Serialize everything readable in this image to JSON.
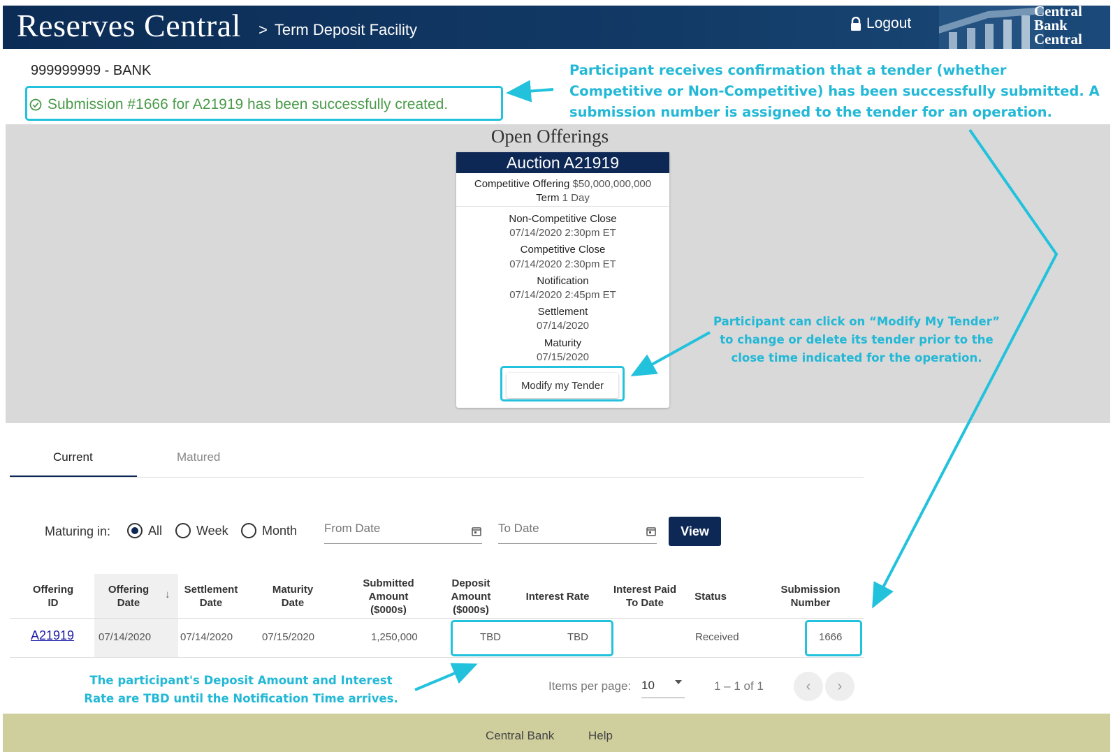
{
  "header": {
    "app_title": "Reserves Central",
    "breadcrumb_sep": ">",
    "breadcrumb": "Term Deposit Facility",
    "logout_label": "Logout",
    "logo_lines": [
      "Central",
      "Bank",
      "Central"
    ]
  },
  "institution": "999999999 - BANK",
  "success_message": "Submission #1666 for A21919 has been successfully created.",
  "annotations": {
    "confirmation": "Participant receives confirmation that a tender (whether Competitive or Non-Competitive) has been successfully submitted. A submission number is assigned to the tender for an operation.",
    "modify": "Participant can click on “Modify My Tender” to change or delete its tender prior to the close time indicated for the operation.",
    "tbd": "The participant's Deposit Amount and Interest Rate are TBD until the Notification Time arrives."
  },
  "offerings": {
    "title": "Open Offerings",
    "auction": {
      "title": "Auction A21919",
      "offering_label": "Competitive Offering",
      "offering_value": "$50,000,000,000",
      "term_label": "Term",
      "term_value": "1 Day",
      "schedule": [
        {
          "label": "Non-Competitive Close",
          "value": "07/14/2020 2:30pm ET"
        },
        {
          "label": "Competitive Close",
          "value": "07/14/2020 2:30pm ET"
        },
        {
          "label": "Notification",
          "value": "07/14/2020 2:45pm ET"
        },
        {
          "label": "Settlement",
          "value": "07/14/2020"
        },
        {
          "label": "Maturity",
          "value": "07/15/2020"
        }
      ],
      "modify_label": "Modify my Tender"
    }
  },
  "tabs": [
    {
      "label": "Current",
      "active": true
    },
    {
      "label": "Matured",
      "active": false
    }
  ],
  "filters": {
    "maturing_label": "Maturing in:",
    "options": [
      {
        "label": "All",
        "selected": true
      },
      {
        "label": "Week",
        "selected": false
      },
      {
        "label": "Month",
        "selected": false
      }
    ],
    "from_placeholder": "From Date",
    "to_placeholder": "To Date",
    "view_label": "View"
  },
  "table": {
    "headers": [
      {
        "line1": "Offering",
        "line2": "ID"
      },
      {
        "line1": "Offering",
        "line2": "Date"
      },
      {
        "line1": "Settlement",
        "line2": "Date"
      },
      {
        "line1": "Maturity",
        "line2": "Date"
      },
      {
        "line1": "Submitted",
        "line2": "Amount",
        "line3": "($000s)"
      },
      {
        "line1": "Deposit",
        "line2": "Amount",
        "line3": "($000s)"
      },
      {
        "line1": "Interest Rate"
      },
      {
        "line1": "Interest Paid",
        "line2": "To Date"
      },
      {
        "line1": "Status"
      },
      {
        "line1": "Submission",
        "line2": "Number"
      }
    ],
    "sort_indicator": "↓",
    "row": {
      "offering_id": "A21919",
      "offering_date": "07/14/2020",
      "settlement_date": "07/14/2020",
      "maturity_date": "07/15/2020",
      "submitted_amount": "1,250,000",
      "deposit_amount": "TBD",
      "interest_rate": "TBD",
      "interest_paid": "",
      "status": "Received",
      "submission_number": "1666"
    }
  },
  "paginator": {
    "items_per_page_label": "Items per page:",
    "items_per_page": "10",
    "range": "1 – 1 of 1",
    "prev": "‹",
    "next": "›"
  },
  "footer": {
    "links": [
      "Central Bank",
      "Help"
    ]
  },
  "colors": {
    "header_bg": "#0d2855",
    "highlight": "#22c2dc",
    "success": "#4a9a4a",
    "footer_bg": "#cfcf9e"
  }
}
